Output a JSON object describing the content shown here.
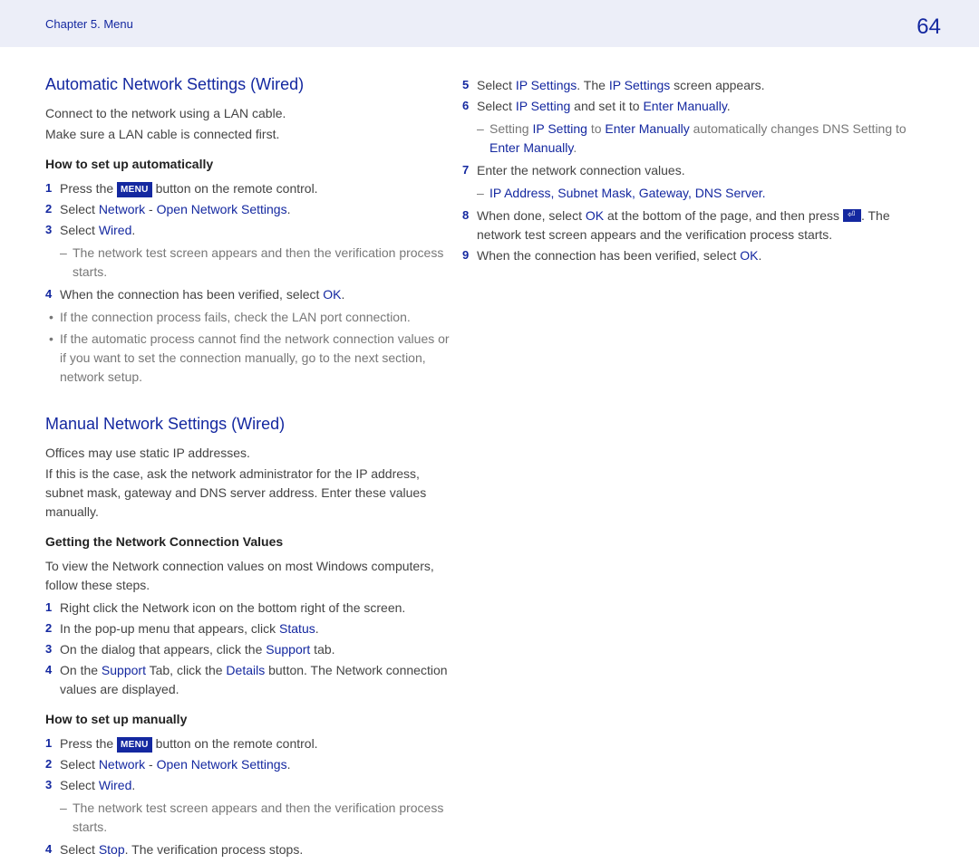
{
  "header": {
    "chapter": "Chapter 5. Menu",
    "page": "64"
  },
  "left": {
    "h2a": "Automatic Network Settings (Wired)",
    "p_a1": "Connect to the network using a LAN cable.",
    "p_a2": "Make sure a LAN cable is connected first.",
    "h3a": "How to set up automatically",
    "auto_steps": {
      "s1a": "Press the ",
      "s1b": "MENU",
      "s1c": " button on the remote control.",
      "s2a": "Select ",
      "s2b": "Network",
      "s2sep": " - ",
      "s2c": "Open Network Settings",
      "s2d": ".",
      "s3a": "Select ",
      "s3b": "Wired",
      "s3c": ".",
      "s3sub": "The network test screen appears and then the verification process starts.",
      "s4a": "When the connection has been verified, select ",
      "s4b": "OK",
      "s4c": "."
    },
    "bullets": {
      "b1": "If the connection process fails, check the LAN port connection.",
      "b2": "If the automatic process cannot find the network connection values or if you want to set the connection manually, go to the next section, network setup."
    },
    "h2b": "Manual Network Settings (Wired)",
    "p_b1": "Offices may use static IP addresses.",
    "p_b2": "If this is the case, ask the network administrator for the IP address, subnet mask, gateway and DNS server address. Enter these values manually.",
    "h3b": "Getting the Network Connection Values",
    "p_b3": "To view the Network connection values on most Windows computers, follow these steps.",
    "get_steps": {
      "s1": "Right click the Network icon on the bottom right of the screen.",
      "s2a": "In the pop-up menu that appears, click ",
      "s2b": "Status",
      "s2c": ".",
      "s3a": "On the dialog that appears, click the ",
      "s3b": "Support",
      "s3c": " tab.",
      "s4a": "On the ",
      "s4b": "Support",
      "s4c": " Tab, click the ",
      "s4d": "Details",
      "s4e": " button. The Network connection values are displayed."
    },
    "h3c": "How to set up manually",
    "man_steps": {
      "s1a": "Press the ",
      "s1b": "MENU",
      "s1c": " button on the remote control.",
      "s2a": "Select ",
      "s2b": "Network",
      "s2sep": " - ",
      "s2c": "Open Network Settings",
      "s2d": ".",
      "s3a": "Select ",
      "s3b": "Wired",
      "s3c": ".",
      "s3sub": "The network test screen appears and then the verification process starts.",
      "s4a": "Select ",
      "s4b": "Stop",
      "s4c": ". The verification process stops."
    }
  },
  "right": {
    "steps": {
      "s5a": "Select ",
      "s5b": "IP Settings",
      "s5c": ". The ",
      "s5d": "IP Settings",
      "s5e": " screen appears.",
      "s6a": "Select ",
      "s6b": "IP Setting",
      "s6c": " and set it to ",
      "s6d": "Enter Manually",
      "s6e": ".",
      "s6sub_a": "Setting ",
      "s6sub_b": "IP Setting",
      "s6sub_c": " to ",
      "s6sub_d": "Enter Manually",
      "s6sub_e": " automatically changes DNS Setting to ",
      "s6sub_f": "Enter Manually",
      "s6sub_g": ".",
      "s7": "Enter the network connection values.",
      "s7sub_a": "IP Address",
      "s7sub_b": "Subnet Mask",
      "s7sub_c": "Gateway",
      "s7sub_d": "DNS Server",
      "s8a": "When done, select ",
      "s8b": "OK",
      "s8c": " at the bottom of the page, and then press ",
      "s8d": ". The network test screen appears and the verification process starts.",
      "s9a": "When the connection has been verified, select ",
      "s9b": "OK",
      "s9c": "."
    }
  },
  "sep": ", "
}
